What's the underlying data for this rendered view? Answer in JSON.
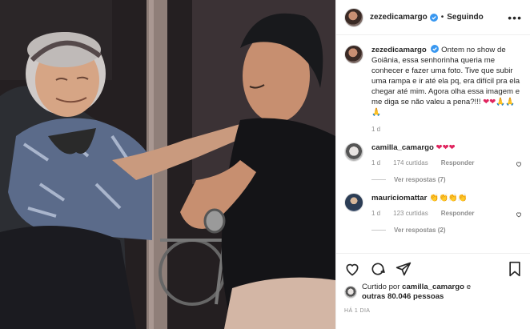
{
  "post": {
    "author": "zezedicamargo",
    "dot": "•",
    "follow_status": "Seguindo",
    "more": "•••",
    "caption": "Ontem no show de Goiânia, essa senhorinha queria me conhecer e fazer uma foto. Tive que subir uma rampa e ir até ela pq, era difícil pra ela chegar até mim. Agora olha essa imagem e me diga se não valeu a pena?!!!",
    "caption_emojis": [
      "❤",
      "❤",
      "🙏",
      "🙏",
      "🙏"
    ],
    "caption_time": "1 d",
    "liked_by_prefix": "Curtido por",
    "liked_by_user": "camilla_camargo",
    "liked_by_joiner": "e",
    "liked_by_others": "outras 80.046 pessoas",
    "posted_ago": "HÁ 1 DIA"
  },
  "comments": [
    {
      "user": "camilla_camargo",
      "emojis": [
        "❤",
        "❤",
        "❤"
      ],
      "time": "1 d",
      "likes": "174 curtidas",
      "reply": "Responder",
      "view_replies": "Ver respostas (7)"
    },
    {
      "user": "mauriciomattar",
      "emojis": [
        "👏",
        "👏",
        "👏",
        "👏"
      ],
      "time": "1 d",
      "likes": "123 curtidas",
      "reply": "Responder",
      "view_replies": "Ver respostas (2)"
    }
  ],
  "icons": {
    "verified": "verified-badge-icon",
    "like": "heart-icon",
    "comment": "comment-bubble-icon",
    "share": "paper-plane-icon",
    "save": "bookmark-icon"
  },
  "colors": {
    "verified": "#3897f0",
    "heart": "#e0245e",
    "muted": "#8e8e8e",
    "border": "#efefef"
  }
}
